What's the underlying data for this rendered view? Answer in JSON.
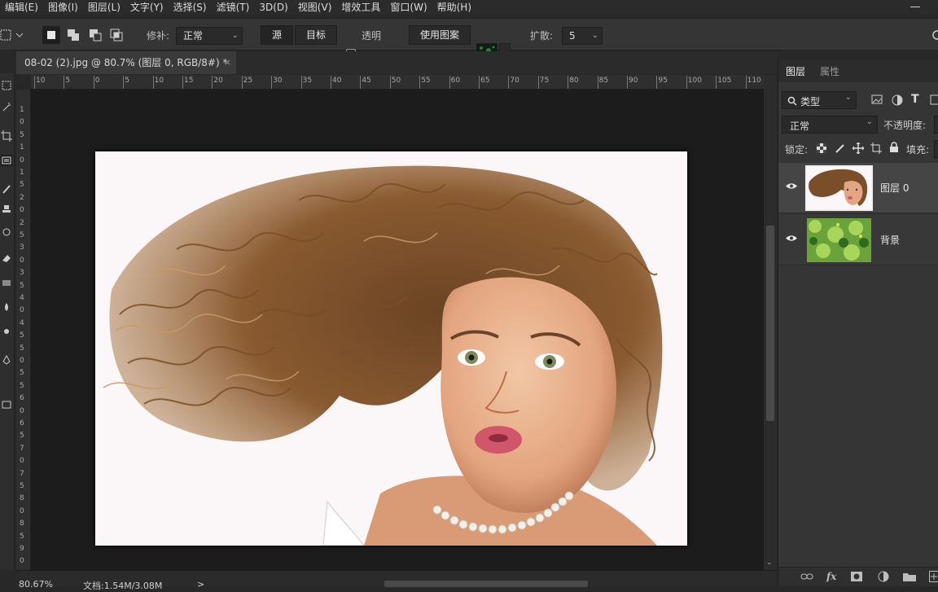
{
  "menu": [
    "编辑(E)",
    "图像(I)",
    "图层(L)",
    "文字(Y)",
    "选择(S)",
    "滤镜(T)",
    "3D(D)",
    "视图(V)",
    "增效工具",
    "窗口(W)",
    "帮助(H)"
  ],
  "options": {
    "patch_label": "修补:",
    "patch_mode": "正常",
    "source_button": "源",
    "target_button": "目标",
    "transparent_label": "透明",
    "use_pattern_button": "使用图案",
    "diffusion_label": "扩散:",
    "diffusion_value": "5"
  },
  "document": {
    "tab_title": "08-02 (2).jpg @ 80.7% (图层 0, RGB/8#) *",
    "close_glyph": "×"
  },
  "ruler": {
    "h_labels": [
      "10",
      "5",
      "0",
      "5",
      "10",
      "15",
      "20",
      "25",
      "30",
      "35",
      "40",
      "45",
      "50",
      "55",
      "60",
      "65",
      "70",
      "75",
      "80",
      "85",
      "90",
      "95",
      "100",
      "105",
      "110"
    ],
    "v_labels": [
      "1",
      "0",
      "5",
      "1",
      "0",
      "1",
      "5",
      "2",
      "0",
      "2",
      "5",
      "3",
      "0",
      "3",
      "5",
      "4",
      "0",
      "4",
      "5",
      "5",
      "0",
      "5",
      "5",
      "6",
      "0",
      "6",
      "5",
      "7",
      "0",
      "7",
      "5",
      "8",
      "0",
      "8",
      "5",
      "9",
      "0",
      "9",
      "5"
    ]
  },
  "status": {
    "zoom": "80.67%",
    "doc_size": "文档:1.54M/3.08M",
    "arrow": ">"
  },
  "panel": {
    "tab_layers": "图层",
    "tab_properties": "属性",
    "filter_kind": "类型",
    "blend_mode": "正常",
    "opacity_label": "不透明度:",
    "lock_label": "锁定:",
    "fill_label": "填充:",
    "layers": [
      {
        "name": "图层 0",
        "visible": true,
        "selected": true
      },
      {
        "name": "背景",
        "visible": true,
        "selected": false
      }
    ],
    "bottom_icons": [
      "link-icon",
      "fx-icon",
      "mask-icon",
      "adjustment-icon",
      "group-icon",
      "new-layer-icon"
    ]
  },
  "colors": {
    "accent_selected_row": "#454545",
    "canvas_bg": "#1c1c1c",
    "panel_bg": "#353535"
  }
}
